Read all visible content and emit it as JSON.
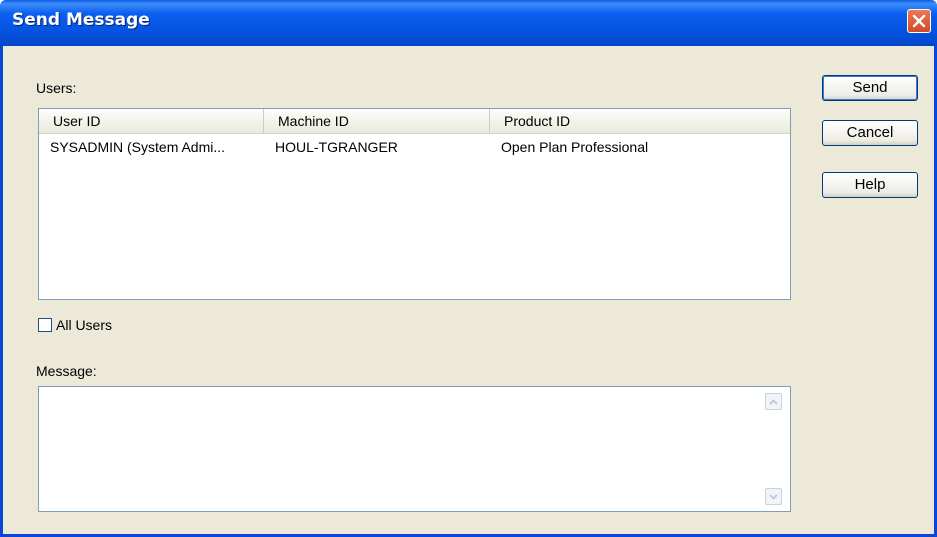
{
  "window": {
    "title": "Send Message"
  },
  "users_section": {
    "label": "Users:",
    "columns": [
      "User ID",
      "Machine ID",
      "Product ID"
    ],
    "rows": [
      {
        "user_id": "SYSADMIN (System Admi...",
        "machine_id": "HOUL-TGRANGER",
        "product_id": "Open Plan Professional"
      }
    ]
  },
  "all_users": {
    "label": "All Users",
    "checked": false
  },
  "message_section": {
    "label": "Message:",
    "value": ""
  },
  "buttons": {
    "send": "Send",
    "cancel": "Cancel",
    "help": "Help"
  }
}
